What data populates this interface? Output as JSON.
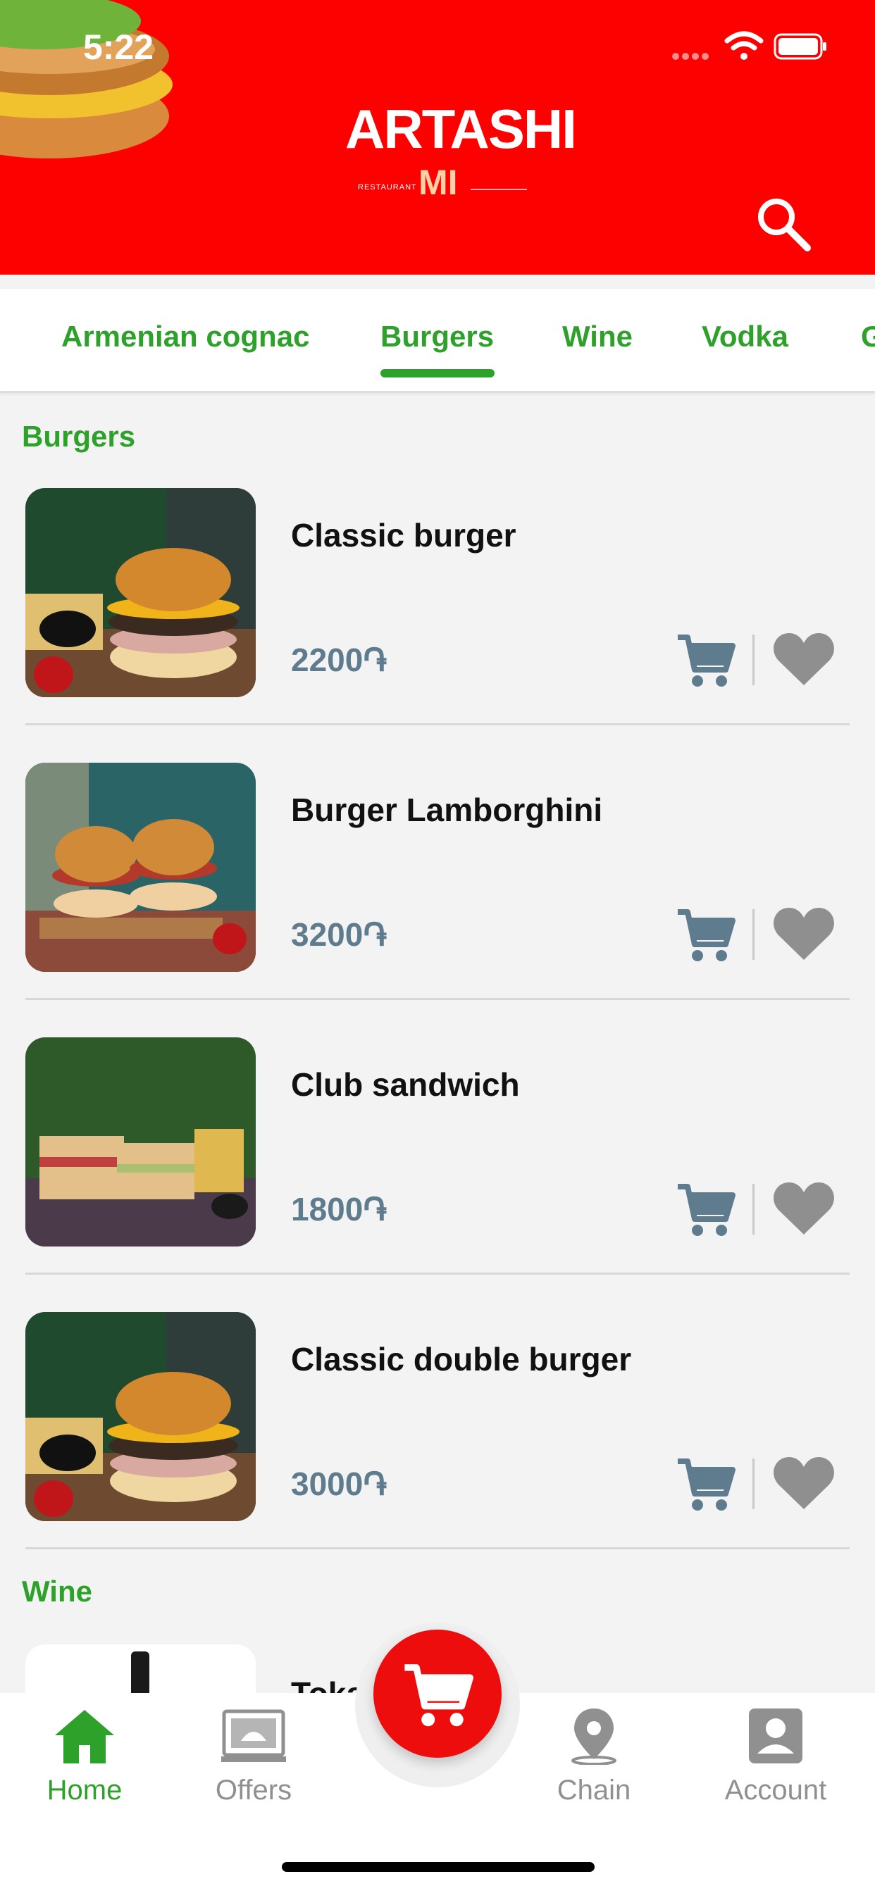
{
  "status_bar": {
    "time": "5:22"
  },
  "header": {
    "logo_word": "ARTASHI",
    "logo_sub": "RESTAURANT",
    "logo_mark": "MI"
  },
  "tabs": [
    {
      "label": "Armenian cognac",
      "active": false
    },
    {
      "label": "Burgers",
      "active": true
    },
    {
      "label": "Wine",
      "active": false
    },
    {
      "label": "Vodka",
      "active": false
    },
    {
      "label": "G",
      "active": false
    }
  ],
  "sections": [
    {
      "title": "Burgers",
      "items": [
        {
          "name": "Classic burger",
          "price": "2200֏"
        },
        {
          "name": "Burger Lamborghini",
          "price": "3200֏"
        },
        {
          "name": "Club sandwich",
          "price": "1800֏"
        },
        {
          "name": "Classic double burger",
          "price": "3000֏"
        }
      ]
    },
    {
      "title": "Wine",
      "items": [
        {
          "name": "Tokar",
          "price": ""
        }
      ]
    }
  ],
  "bottom_nav": [
    {
      "label": "Home",
      "icon": "home-icon",
      "active": true
    },
    {
      "label": "Offers",
      "icon": "offers-icon",
      "active": false
    },
    {
      "label": "Chain",
      "icon": "location-pin-icon",
      "active": false
    },
    {
      "label": "Account",
      "icon": "account-icon",
      "active": false
    }
  ],
  "colors": {
    "brand_red": "#fd0000",
    "accent_green": "#2ea12a",
    "price_slate": "#5e7c8e",
    "icon_gray": "#909090"
  }
}
